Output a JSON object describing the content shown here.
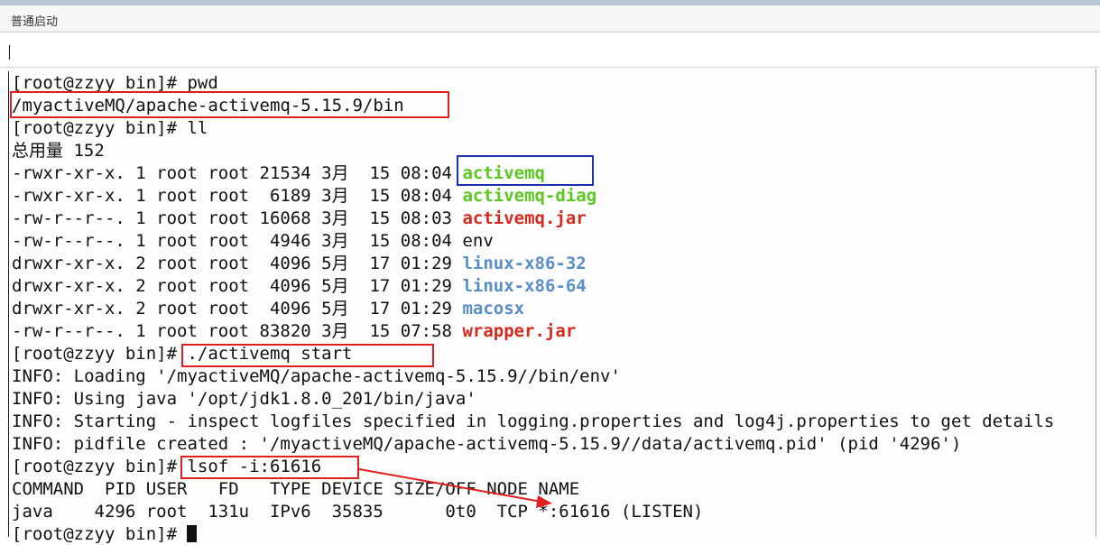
{
  "window": {
    "title": "普通启动"
  },
  "terminal": {
    "lines": [
      [
        {
          "text": "[root@zzyy bin]# pwd",
          "style": "plain"
        }
      ],
      [
        {
          "text": "/myactiveMQ/apache-activemq-5.15.9/bin",
          "style": "plain"
        }
      ],
      [
        {
          "text": "[root@zzyy bin]# ll",
          "style": "plain"
        }
      ],
      [
        {
          "text": "总用量 152",
          "style": "plain"
        }
      ],
      [
        {
          "text": "-rwxr-xr-x. 1 root root 21534 3月  15 08:04 ",
          "style": "plain"
        },
        {
          "text": "activemq",
          "style": "green"
        }
      ],
      [
        {
          "text": "-rwxr-xr-x. 1 root root  6189 3月  15 08:04 ",
          "style": "plain"
        },
        {
          "text": "activemq-diag",
          "style": "green"
        }
      ],
      [
        {
          "text": "-rw-r--r--. 1 root root 16068 3月  15 08:03 ",
          "style": "plain"
        },
        {
          "text": "activemq.jar",
          "style": "red"
        }
      ],
      [
        {
          "text": "-rw-r--r--. 1 root root  4946 3月  15 08:04 env",
          "style": "plain"
        }
      ],
      [
        {
          "text": "drwxr-xr-x. 2 root root  4096 5月  17 01:29 ",
          "style": "plain"
        },
        {
          "text": "linux-x86-32",
          "style": "blue"
        }
      ],
      [
        {
          "text": "drwxr-xr-x. 2 root root  4096 5月  17 01:29 ",
          "style": "plain"
        },
        {
          "text": "linux-x86-64",
          "style": "blue"
        }
      ],
      [
        {
          "text": "drwxr-xr-x. 2 root root  4096 5月  17 01:29 ",
          "style": "plain"
        },
        {
          "text": "macosx",
          "style": "blue"
        }
      ],
      [
        {
          "text": "-rw-r--r--. 1 root root 83820 3月  15 07:58 ",
          "style": "plain"
        },
        {
          "text": "wrapper.jar",
          "style": "red"
        }
      ],
      [
        {
          "text": "[root@zzyy bin]# ./activemq start",
          "style": "plain"
        }
      ],
      [
        {
          "text": "INFO: Loading '/myactiveMQ/apache-activemq-5.15.9//bin/env'",
          "style": "plain"
        }
      ],
      [
        {
          "text": "INFO: Using java '/opt/jdk1.8.0_201/bin/java'",
          "style": "plain"
        }
      ],
      [
        {
          "text": "INFO: Starting - inspect logfiles specified in logging.properties and log4j.properties to get details",
          "style": "plain"
        }
      ],
      [
        {
          "text": "INFO: pidfile created : '/myactiveMQ/apache-activemq-5.15.9//data/activemq.pid' (pid '4296')",
          "style": "plain"
        }
      ],
      [
        {
          "text": "[root@zzyy bin]# lsof -i:61616",
          "style": "plain"
        }
      ],
      [
        {
          "text": "COMMAND  PID USER   FD   TYPE DEVICE SIZE/OFF NODE NAME",
          "style": "plain"
        }
      ],
      [
        {
          "text": "java    4296 root  131u  IPv6  35835      0t0  TCP *:61616 (LISTEN)",
          "style": "plain"
        }
      ],
      [
        {
          "text": "[root@zzyy bin]# ",
          "style": "plain"
        }
      ]
    ]
  },
  "colors": {
    "highlight_red": "#e02020",
    "highlight_blue": "#1c2fb0",
    "exec_green": "#5cc724",
    "archive_red": "#d42a1e",
    "dir_blue": "#5a8fc6"
  }
}
